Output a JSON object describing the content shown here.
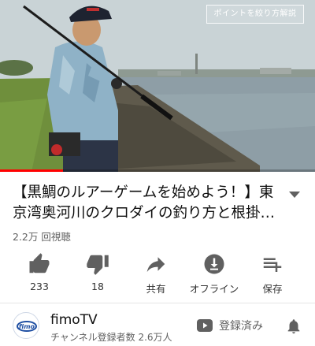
{
  "video": {
    "watermark_text": "ポイントを絞り方解説",
    "progress_fraction": 0.2
  },
  "title": {
    "text": "【黒鯛のルアーゲームを始めよう！】東京湾奥河川のクロダイの釣り方と根掛かり…",
    "views": "2.2万 回視聴"
  },
  "actions": {
    "like": {
      "icon": "thumbs-up-icon",
      "label": "233"
    },
    "dislike": {
      "icon": "thumbs-down-icon",
      "label": "18"
    },
    "share": {
      "icon": "share-icon",
      "label": "共有"
    },
    "offline": {
      "icon": "download-icon",
      "label": "オフライン"
    },
    "save": {
      "icon": "add-to-playlist-icon",
      "label": "保存"
    }
  },
  "channel": {
    "name": "fimoTV",
    "subscribers": "チャンネル登録者数 2.6万人",
    "avatar_logo_text": "fimo",
    "subscribe_state": "登録済み",
    "subscribed_icon": "youtube-play-icon",
    "bell_icon": "bell-icon"
  },
  "colors": {
    "progress": "#ff0000",
    "icon": "#606060",
    "text_secondary": "#606060"
  }
}
